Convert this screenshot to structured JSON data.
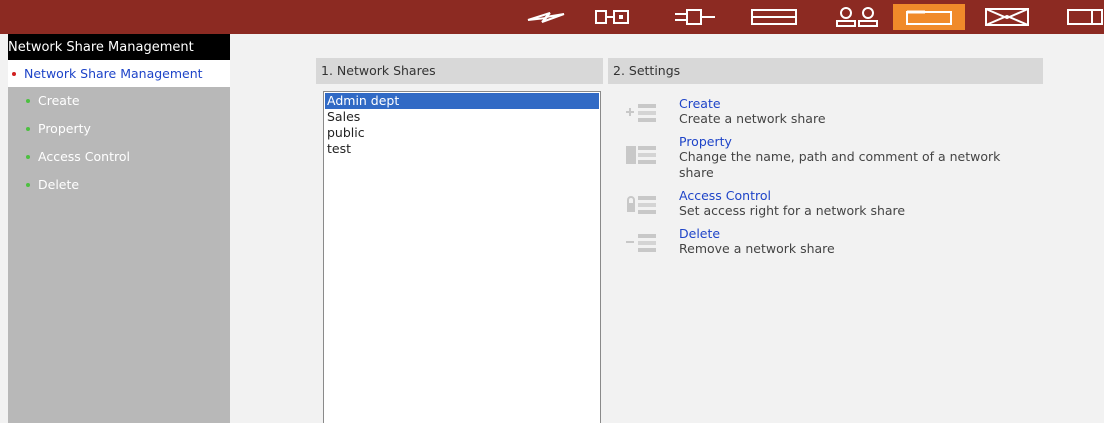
{
  "topbar": {
    "icons": [
      "lightning-icon",
      "connector-icon",
      "plug-icon",
      "panel-icon",
      "users-icon",
      "folder-icon",
      "mail-icon",
      "window-icon"
    ],
    "active_index": 5
  },
  "sidebar": {
    "title": "Network Share Management",
    "items": [
      {
        "label": "Network Share Management"
      },
      {
        "label": "Create"
      },
      {
        "label": "Property"
      },
      {
        "label": "Access Control"
      },
      {
        "label": "Delete"
      }
    ]
  },
  "shares_panel": {
    "header": "1. Network Shares",
    "items": [
      "Admin dept",
      "Sales",
      "public",
      "test"
    ],
    "selected": "Admin dept"
  },
  "settings_panel": {
    "header": "2. Settings",
    "actions": [
      {
        "title": "Create",
        "desc": "Create a network share",
        "icon": "add-share-icon"
      },
      {
        "title": "Property",
        "desc": "Change the name, path and comment of a network share",
        "icon": "property-share-icon"
      },
      {
        "title": "Access Control",
        "desc": "Set access right for a network share",
        "icon": "lock-share-icon"
      },
      {
        "title": "Delete",
        "desc": "Remove a network share",
        "icon": "remove-share-icon"
      }
    ]
  },
  "colors": {
    "topbar": "#8c2a22",
    "active_tab": "#f08a2a",
    "link": "#1e44c8",
    "selection": "#316ac5"
  }
}
